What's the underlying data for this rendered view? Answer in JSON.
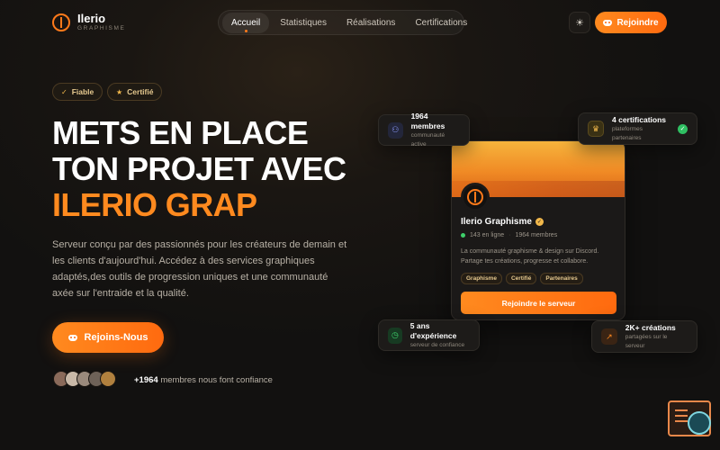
{
  "brand": {
    "name": "Ilerio",
    "subtitle": "GRAPHISME"
  },
  "nav": {
    "items": [
      {
        "label": "Accueil",
        "active": true
      },
      {
        "label": "Statistiques"
      },
      {
        "label": "Réalisations"
      },
      {
        "label": "Certifications"
      }
    ],
    "theme_icon": "sun-icon",
    "join_label": "Rejoindre"
  },
  "badges": [
    {
      "label": "Fiable",
      "icon": "check-icon"
    },
    {
      "label": "Certifié",
      "icon": "star-icon"
    }
  ],
  "hero": {
    "line1": "METS EN PLACE",
    "line2": "TON PROJET AVEC",
    "line3": "ILERIO GRAP",
    "description": "Serveur conçu par des passionnés pour les créateurs de demain et les clients d'aujourd'hui. Accédez à des services graphiques adaptés,des outils de progression uniques et une communauté axée sur l'entraide et la qualité.",
    "cta_label": "Rejoins-Nous",
    "trust_count": "+1964",
    "trust_text": "membres nous font confiance"
  },
  "floating": {
    "members": {
      "title": "1964 membres",
      "sub": "communauté active",
      "icon": "users-icon"
    },
    "certs": {
      "title": "4 certifications",
      "sub": "plateformes partenaires",
      "icon": "award-icon"
    },
    "experience": {
      "title": "5 ans d'expérience",
      "sub": "serveur de confiance",
      "icon": "clock-icon"
    },
    "creations": {
      "title": "2K+ créations",
      "sub": "partagées sur le serveur",
      "icon": "trend-icon"
    }
  },
  "server_card": {
    "name": "Ilerio Graphisme",
    "online": "143 en ligne",
    "members": "1964 membres",
    "description": "La communauté graphisme & design sur Discord. Partage tes créations, progresse et collabore.",
    "tags": [
      "Graphisme",
      "Certifié",
      "Partenaires"
    ],
    "button_label": "Rejoindre le serveur"
  },
  "colors": {
    "accent": "#ff7a1a",
    "background": "#141210",
    "badge_text": "#e6c98f"
  }
}
